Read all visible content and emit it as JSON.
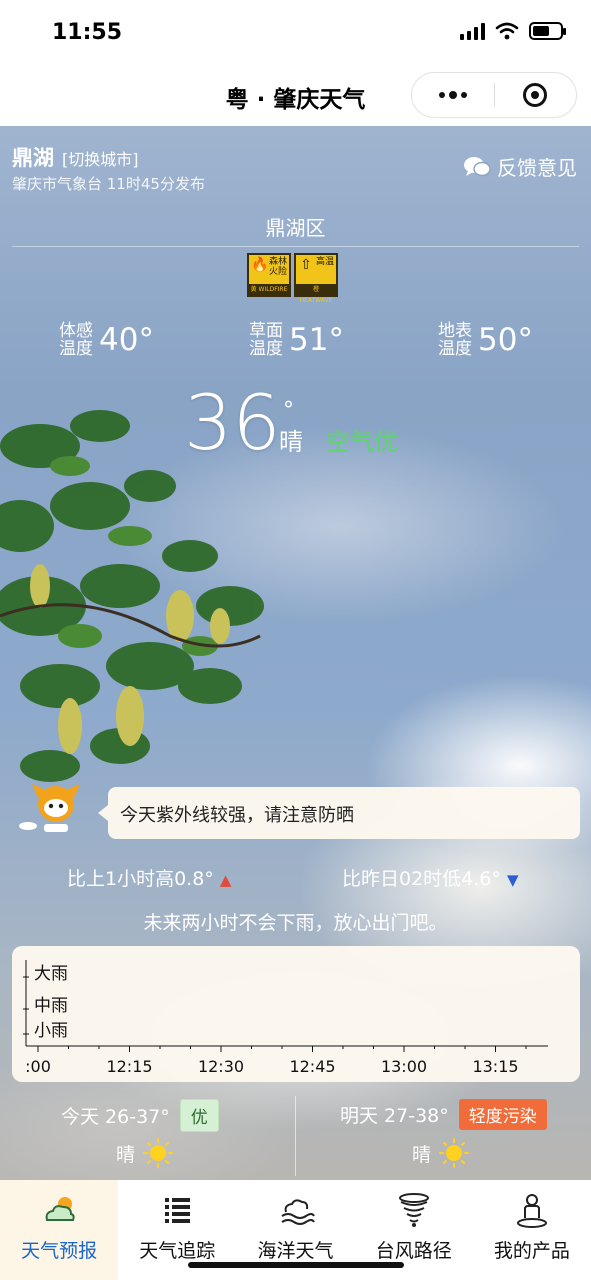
{
  "status_bar": {
    "time": "11:55"
  },
  "nav": {
    "title": "粤 · 肇庆天气"
  },
  "header": {
    "city": "鼎湖",
    "switch_city": "[切换城市]",
    "publish_info": "肇庆市气象台 11时45分发布",
    "feedback": "反馈意见",
    "district": "鼎湖区"
  },
  "warnings": [
    {
      "name": "森林火险",
      "level": "黄",
      "en": "WILDFIRE",
      "color": "#f0c419"
    },
    {
      "name": "高温",
      "level": "橙",
      "en": "HEATWAVE",
      "color": "#f0c419"
    }
  ],
  "metrics": [
    {
      "label": "体感温度",
      "value": "40°"
    },
    {
      "label": "草面温度",
      "value": "51°"
    },
    {
      "label": "地表温度",
      "value": "50°"
    }
  ],
  "current": {
    "temperature": "36",
    "degree_symbol": "°",
    "weather": "晴",
    "air_quality": "空气优",
    "air_quality_color": "#5cd66b"
  },
  "tip": {
    "text": "今天紫外线较强，请注意防晒"
  },
  "comparison": {
    "last_hour": "比上1小时高0.8°",
    "last_hour_arrow": "▲",
    "yesterday": "比昨日02时低4.6°",
    "yesterday_arrow": "▼"
  },
  "rain_message": "未来两小时不会下雨，放心出门吧。",
  "chart_data": {
    "type": "line",
    "y_levels": [
      "大雨",
      "中雨",
      "小雨"
    ],
    "x_labels": [
      ":00",
      "12:15",
      "12:30",
      "12:45",
      "13:00",
      "13:15"
    ],
    "series": []
  },
  "forecast": {
    "today": {
      "label": "今天 26-37°",
      "aqi": "优",
      "weather": "晴"
    },
    "tomorrow": {
      "label": "明天 27-38°",
      "aqi": "轻度污染",
      "weather": "晴"
    }
  },
  "tabs": [
    {
      "label": "天气预报",
      "icon": "weather-cloud-sun-icon",
      "active": true
    },
    {
      "label": "天气追踪",
      "icon": "list-icon",
      "active": false
    },
    {
      "label": "海洋天气",
      "icon": "ocean-icon",
      "active": false
    },
    {
      "label": "台风路径",
      "icon": "typhoon-icon",
      "active": false
    },
    {
      "label": "我的产品",
      "icon": "person-icon",
      "active": false
    }
  ],
  "colors": {
    "active_tab": "#1a66c9",
    "rise_arrow": "#e04b3a",
    "fall_arrow": "#2c5fd6",
    "pollution_badge": "#f06c3a"
  }
}
